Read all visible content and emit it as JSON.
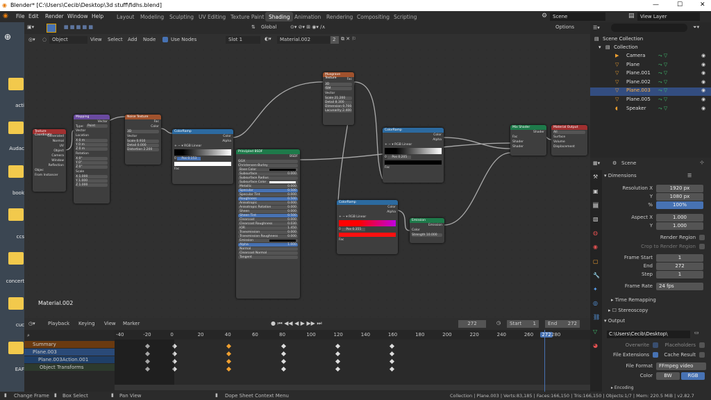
{
  "window": {
    "title": "Blender* [C:\\Users\\Cecib\\Desktop\\3d stuff\\fidhs.blend]",
    "minimize": "—",
    "maximize": "☐",
    "close": "✕"
  },
  "menu": [
    "File",
    "Edit",
    "Render",
    "Window",
    "Help"
  ],
  "workspaces": [
    "Layout",
    "Modeling",
    "Sculpting",
    "UV Editing",
    "Texture Paint",
    "Shading",
    "Animation",
    "Rendering",
    "Compositing",
    "Scripting"
  ],
  "scene_field": "Scene",
  "view_layer_field": "View Layer",
  "toolrow": {
    "orientation": "Global",
    "options": "Options"
  },
  "node_header": {
    "object": "Object",
    "view": "View",
    "select": "Select",
    "add": "Add",
    "node": "Node",
    "use_nodes": "Use Nodes",
    "slot": "Slot 1",
    "material": "Material.002",
    "users": "2"
  },
  "editor_label": "Material.002",
  "desktop_labels": [
    "acti",
    "Audac",
    "book",
    "ccs",
    "concert",
    "cuc",
    "EAF"
  ],
  "nodes": {
    "texcoord": {
      "title": "Texture Coordinate",
      "outputs": [
        "Generated",
        "Normal",
        "UV",
        "Object",
        "Camera",
        "Window",
        "Reflection"
      ],
      "object_label": "Objec",
      "from_instancer": "From Instancer"
    },
    "mapping": {
      "title": "Mapping",
      "vector_out": "Vector",
      "type_label": "Type:",
      "type": "Point",
      "vector": "Vector",
      "location": "Location",
      "rotation": "Rotation",
      "scale": "Scale",
      "loc": [
        "X 0 m",
        "Y 0 m",
        "Z 0 m"
      ],
      "rot": [
        "X 0°",
        "Y 0°",
        "Z 0°"
      ],
      "scl": [
        "X 1.000",
        "Y 1.000",
        "Z 1.000"
      ]
    },
    "noise": {
      "title": "Noise Texture",
      "fac": "Fac",
      "color": "Color",
      "dim": "3D",
      "vector": "Vector",
      "scale": "Scale 0.910",
      "detail": "Detail 0.000",
      "distortion": "Distortion 2.200"
    },
    "cramp1": {
      "title": "ColorRamp",
      "color": "Color",
      "alpha": "Alpha",
      "mode": "RGB",
      "interp": "Linear",
      "index": "0",
      "pos": "Pos 0.153",
      "fac": "Fac"
    },
    "musgrave": {
      "title": "Musgrave Texture",
      "fac": "Fac",
      "dim": "3D",
      "type": "fBM",
      "vector": "Vector",
      "scale": "Scale 21.200",
      "detail": "Detail 8.300",
      "dimension": "Dimension 0.700",
      "lacunarity": "Lacunarity 2.400"
    },
    "bsdf": {
      "title": "Principled BSDF",
      "out": "BSDF",
      "dist": "GGX",
      "sss": "Christensen-Burley",
      "rows": [
        [
          "Base Color",
          ""
        ],
        [
          "Subsurface",
          "0.000"
        ],
        [
          "Subsurface Radius",
          ""
        ],
        [
          "Subsurface Color",
          ""
        ],
        [
          "Metallic",
          "0.000"
        ],
        [
          "Specular",
          "0.500"
        ],
        [
          "Specular Tint",
          "0.000"
        ],
        [
          "Roughness",
          "0.500"
        ],
        [
          "Anisotropic",
          "0.000"
        ],
        [
          "Anisotropic Rotation",
          "0.000"
        ],
        [
          "Sheen",
          "0.000"
        ],
        [
          "Sheen Tint",
          "0.500"
        ],
        [
          "Clearcoat",
          "0.000"
        ],
        [
          "Clearcoat Roughness",
          "0.030"
        ],
        [
          "IOR",
          "1.450"
        ],
        [
          "Transmission",
          "0.000"
        ],
        [
          "Transmission Roughness",
          "0.000"
        ],
        [
          "Emission",
          ""
        ],
        [
          "Alpha",
          "1.000"
        ],
        [
          "Normal",
          ""
        ],
        [
          "Clearcoat Normal",
          ""
        ],
        [
          "Tangent",
          ""
        ]
      ]
    },
    "cramp2": {
      "title": "ColorRamp",
      "color": "Color",
      "alpha": "Alpha",
      "mode": "RGB",
      "interp": "Linear",
      "index": "0",
      "pos": "Pos 0.205",
      "fac": "Fac"
    },
    "cramp3": {
      "title": "ColorRamp",
      "color": "Color",
      "alpha": "Alpha",
      "mode": "RGB",
      "interp": "Linear",
      "index": "0",
      "pos": "Pos 0.355",
      "fac": "Fac"
    },
    "emission": {
      "title": "Emission",
      "out": "Emission",
      "color": "Color",
      "strength": "Strength 10.000"
    },
    "mix": {
      "title": "Mix Shader",
      "out": "Shader",
      "fac": "Fac",
      "s1": "Shader",
      "s2": "Shader"
    },
    "output": {
      "title": "Material Output",
      "target": "All",
      "surface": "Surface",
      "volume": "Volume",
      "displacement": "Displacement"
    }
  },
  "timeline": {
    "playback": "Playback",
    "keying": "Keying",
    "view": "View",
    "marker": "Marker",
    "current": "272",
    "start_label": "Start",
    "start": "1",
    "end_label": "End",
    "end": "272",
    "ticks": [
      "-40",
      "-20",
      "0",
      "20",
      "40",
      "60",
      "80",
      "100",
      "120",
      "140",
      "160",
      "180",
      "200",
      "220",
      "240",
      "260",
      "272",
      "280"
    ],
    "channels": [
      "Summary",
      "Plane.003",
      "Plane.003Action.001",
      "Object Transforms"
    ],
    "key_frames": [
      -20,
      0,
      40,
      80,
      120,
      160
    ],
    "selected_frame": 40
  },
  "outliner": {
    "title": "Scene Collection",
    "collection": "Collection",
    "items": [
      "Camera",
      "Plane",
      "Plane.001",
      "Plane.002",
      "Plane.003",
      "Plane.005",
      "Speaker"
    ],
    "selected": "Plane.003"
  },
  "props": {
    "scene": "Scene",
    "dimensions": "Dimensions",
    "res_x_label": "Resolution X",
    "res_x": "1920 px",
    "y_label": "Y",
    "res_y": "1080 px",
    "pct_label": "%",
    "pct": "100%",
    "aspect_x_label": "Aspect X",
    "aspect_x": "1.000",
    "aspect_y_label": "Y",
    "aspect_y": "1.000",
    "render_region": "Render Region",
    "crop": "Crop to Render Region",
    "frame_start_label": "Frame Start",
    "frame_start": "1",
    "end_label": "End",
    "end": "272",
    "step_label": "Step",
    "step": "1",
    "frame_rate_label": "Frame Rate",
    "frame_rate": "24 fps",
    "time_remap": "Time Remapping",
    "stereo": "Stereoscopy",
    "output": "Output",
    "path": "C:\\Users\\Cecib\\Desktop\\",
    "overwrite": "Overwrite",
    "placeholders": "Placeholders",
    "file_ext": "File Extensions",
    "cache": "Cache Result",
    "file_format_label": "File Format",
    "file_format": "FFmpeg video",
    "color_label": "Color",
    "bw": "BW",
    "rgb": "RGB",
    "encoding": "Encoding"
  },
  "status": {
    "change_frame": "Change Frame",
    "box_select": "Box Select",
    "pan_view": "Pan View",
    "context": "Dope Sheet Context Menu",
    "stats": "Collection | Plane.003 | Verts:83,185 | Faces:166,150 | Tris:166,150 | Objects:1/7 | Mem: 220.5 MiB | v2.82.7"
  },
  "colors": {
    "accent": "#4772b3",
    "header_teal": "#1a8a6a",
    "header_orange": "#a0522d",
    "header_blue": "#2c6aa0",
    "header_purple": "#6a4aa0",
    "header_red": "#a03030",
    "header_green": "#1e7a4a"
  }
}
